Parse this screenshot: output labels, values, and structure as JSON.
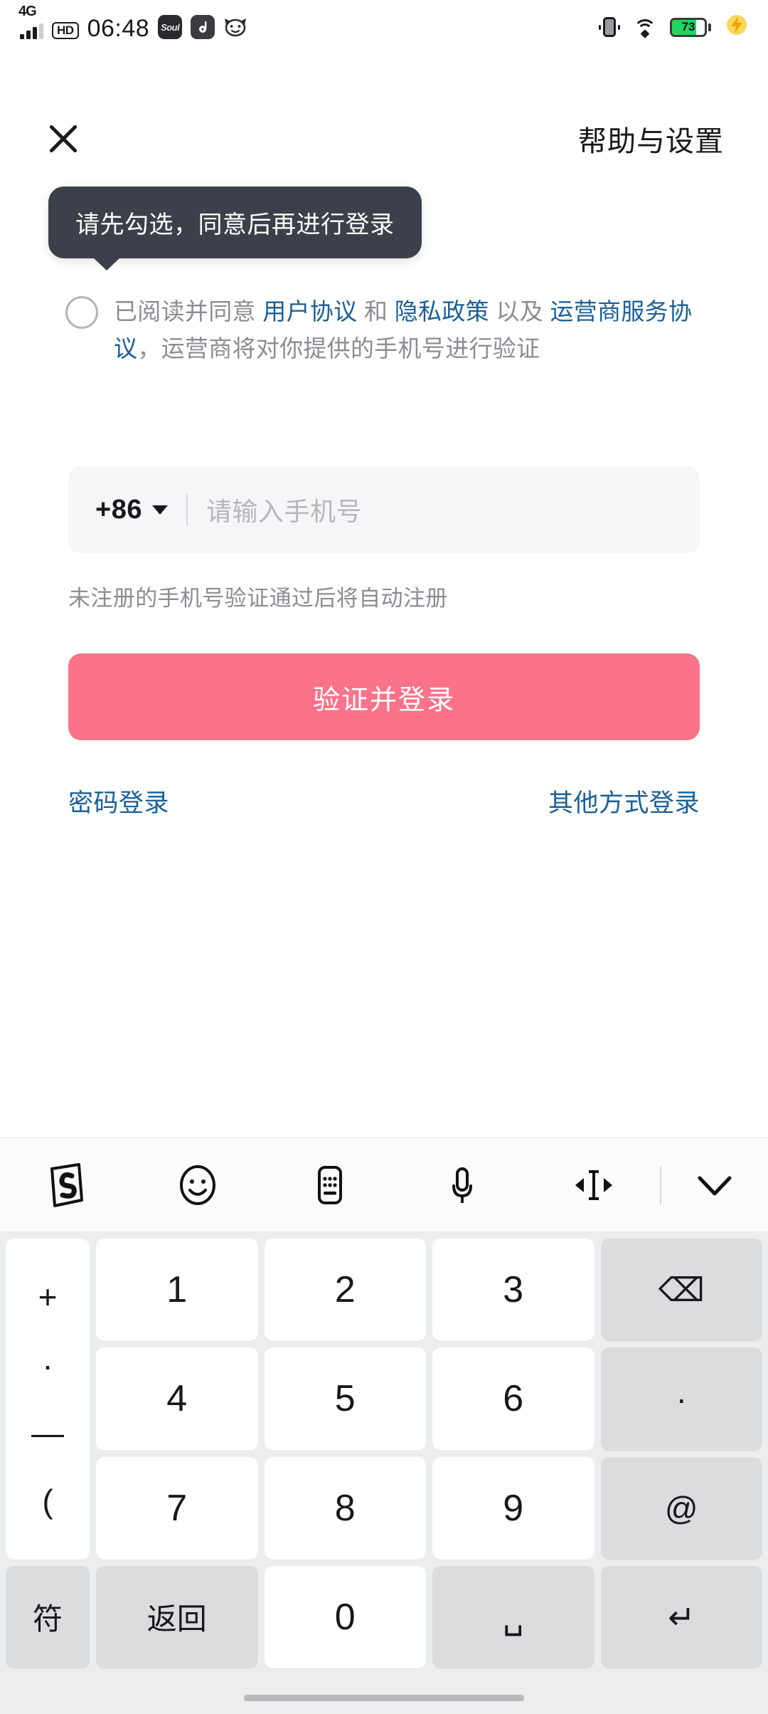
{
  "status_bar": {
    "network_type": "4G",
    "hd_label": "HD",
    "time": "06:48",
    "app_icons": [
      {
        "name": "soul-app-icon",
        "label": "Soul"
      },
      {
        "name": "music-app-icon",
        "label": ""
      },
      {
        "name": "cat-app-icon",
        "label": ""
      }
    ],
    "vibrate_icon": "vibrate-icon",
    "wifi_icon": "wifi-icon",
    "battery_percent": "73",
    "battery_level": 73,
    "charging_icon": "charging-bolt-icon",
    "battery_color": "#1ed760",
    "bolt_color": "#f7c948"
  },
  "header": {
    "close_icon": "close-icon",
    "help_settings_label": "帮助与设置"
  },
  "tooltip": {
    "message": "请先勾选，同意后再进行登录",
    "background": "#3c404a",
    "text_color": "#ffffff"
  },
  "agreement": {
    "checkbox_checked": false,
    "checkbox_name": "agreement-checkbox",
    "part1": "已阅读并同意 ",
    "link1": "用户协议",
    "part2": " 和 ",
    "link2": "隐私政策",
    "part3": " 以及 ",
    "link3": "运营商服务协议",
    "part4": "，运营商将对你提供的手机号进行验证",
    "link_color": "#1b5f96",
    "text_color": "#8c8c93"
  },
  "phone_field": {
    "country_code": "+86",
    "dropdown_icon": "chevron-down-icon",
    "placeholder": "请输入手机号",
    "value": "",
    "background": "#f6f6f8"
  },
  "hint_text": "未注册的手机号验证通过后将自动注册",
  "login_button": {
    "label": "验证并登录",
    "background": "#fa7389",
    "text_color": "#ffffff"
  },
  "secondary_links": {
    "password_login": "密码登录",
    "other_login": "其他方式登录",
    "color": "#1b5f96"
  },
  "keyboard": {
    "toolbar": [
      {
        "name": "sogou-logo-icon",
        "label": "S"
      },
      {
        "name": "emoji-icon",
        "label": ""
      },
      {
        "name": "keyboard-switch-icon",
        "label": ""
      },
      {
        "name": "microphone-icon",
        "label": ""
      },
      {
        "name": "cursor-move-icon",
        "label": ""
      },
      {
        "name": "collapse-keyboard-icon",
        "label": ""
      }
    ],
    "symbol_column": [
      "+",
      "·",
      "—",
      "("
    ],
    "rows": [
      [
        {
          "label": "1",
          "type": "white",
          "name": "key-1"
        },
        {
          "label": "2",
          "type": "white",
          "name": "key-2"
        },
        {
          "label": "3",
          "type": "white",
          "name": "key-3"
        },
        {
          "label": "⌫",
          "type": "gray",
          "name": "backspace-key"
        }
      ],
      [
        {
          "label": "4",
          "type": "white",
          "name": "key-4"
        },
        {
          "label": "5",
          "type": "white",
          "name": "key-5"
        },
        {
          "label": "6",
          "type": "white",
          "name": "key-6"
        },
        {
          "label": "·",
          "type": "gray",
          "name": "period-key"
        }
      ],
      [
        {
          "label": "7",
          "type": "white",
          "name": "key-7"
        },
        {
          "label": "8",
          "type": "white",
          "name": "key-8"
        },
        {
          "label": "9",
          "type": "white",
          "name": "key-9"
        },
        {
          "label": "@",
          "type": "gray",
          "name": "at-key"
        }
      ],
      [
        {
          "label": "返回",
          "type": "gray",
          "name": "return-key"
        },
        {
          "label": "0",
          "type": "white",
          "name": "key-0"
        },
        {
          "label": "␣",
          "type": "gray",
          "name": "space-key"
        },
        {
          "label": "↵",
          "type": "gray",
          "name": "enter-key"
        }
      ]
    ],
    "symbol_key_label": "符",
    "background": "#eceded",
    "key_white": "#ffffff",
    "key_gray": "#dcdcde"
  }
}
